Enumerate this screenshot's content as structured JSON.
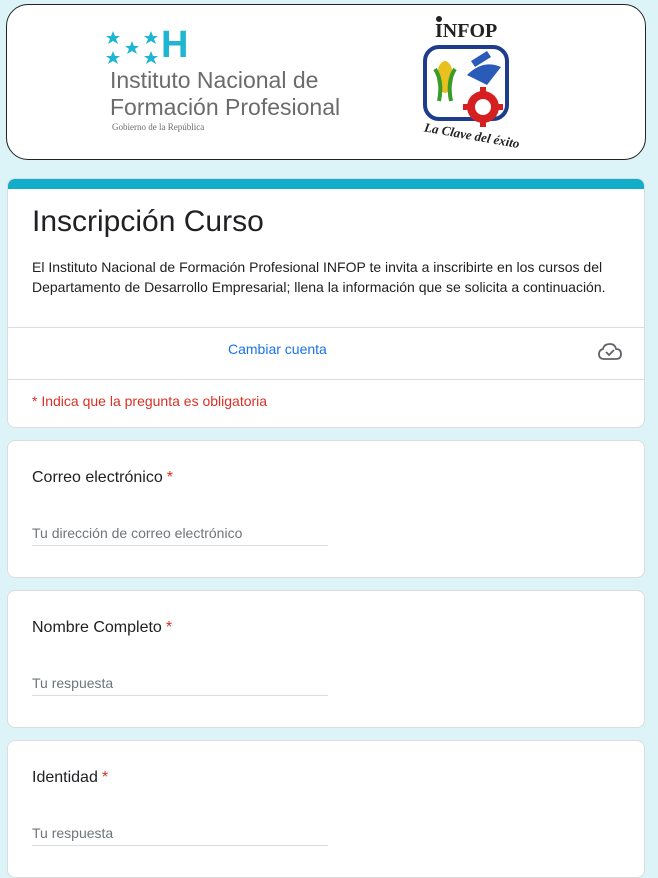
{
  "header": {
    "institute_line1": "Instituto Nacional de",
    "institute_line2": "Formación Profesional",
    "government": "Gobierno de la República",
    "logo_letter": "H",
    "infop_label": "INFOP",
    "infop_slogan": "La Clave del éxito"
  },
  "form": {
    "title": "Inscripción Curso",
    "description": "El Instituto Nacional de Formación Profesional INFOP te invita a inscribirte en los cursos del Departamento de Desarrollo Empresarial; llena la información que se solicita a continuación.",
    "switch_account": "Cambiar cuenta",
    "required_note": "* Indica que la pregunta es obligatoria",
    "accent_color": "#12aec9"
  },
  "questions": [
    {
      "label": "Correo electrónico",
      "required": "*",
      "placeholder": "Tu dirección de correo electrónico"
    },
    {
      "label": "Nombre Completo",
      "required": "*",
      "placeholder": "Tu respuesta"
    },
    {
      "label": "Identidad",
      "required": "*",
      "placeholder": "Tu respuesta"
    }
  ]
}
